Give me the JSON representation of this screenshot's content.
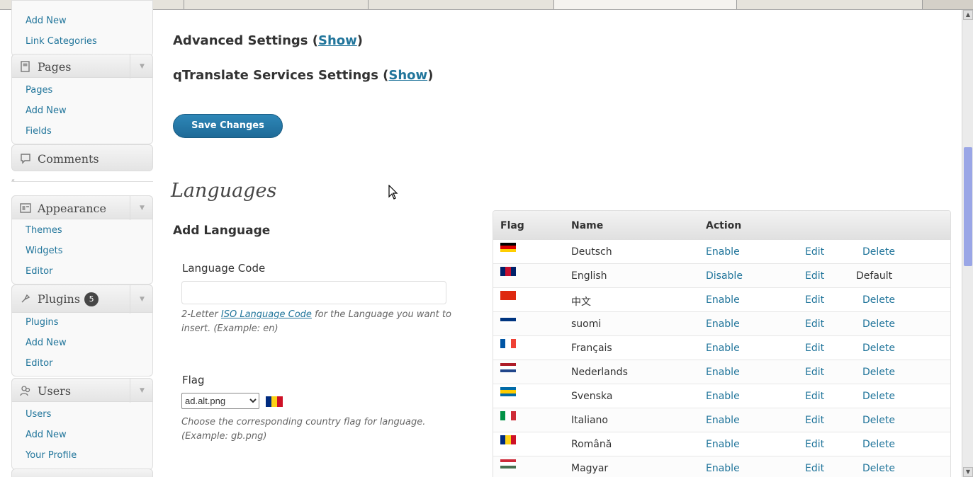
{
  "sidebar": {
    "links_add_new": "Add New",
    "links_categories": "Link Categories",
    "pages": {
      "label": "Pages",
      "items": [
        "Pages",
        "Add New",
        "Fields"
      ]
    },
    "comments": {
      "label": "Comments"
    },
    "appearance": {
      "label": "Appearance",
      "items": [
        "Themes",
        "Widgets",
        "Editor"
      ]
    },
    "plugins": {
      "label": "Plugins",
      "badge": "5",
      "items": [
        "Plugins",
        "Add New",
        "Editor"
      ]
    },
    "users": {
      "label": "Users",
      "items": [
        "Users",
        "Add New",
        "Your Profile"
      ]
    }
  },
  "main": {
    "advanced": {
      "label": "Advanced Settings (",
      "link": "Show",
      "close": ")"
    },
    "services": {
      "label": "qTranslate Services Settings (",
      "link": "Show",
      "close": ")"
    },
    "save_button": "Save Changes",
    "languages_title": "Languages",
    "add_language": "Add Language",
    "code_label": "Language Code",
    "code_value": "",
    "code_hint_pre": "2-Letter ",
    "code_hint_link": "ISO Language Code",
    "code_hint_post": " for the Language you want to insert. (Example: en)",
    "flag_label": "Flag",
    "flag_value": "ad.alt.png",
    "flag_hint": "Choose the corresponding country flag for language. (Example: gb.png)"
  },
  "table": {
    "headers": {
      "flag": "Flag",
      "name": "Name",
      "action": "Action"
    },
    "rows": [
      {
        "name": "Deutsch",
        "action": "Enable",
        "edit": "Edit",
        "last": "Delete",
        "flag": [
          "#000000",
          "#dd0000",
          "#ffce00"
        ],
        "orient": "h"
      },
      {
        "name": "English",
        "action": "Disable",
        "edit": "Edit",
        "last": "Default",
        "flag": [
          "#012169",
          "#c8102e",
          "#012169"
        ],
        "orient": "v"
      },
      {
        "name": "中文",
        "action": "Enable",
        "edit": "Edit",
        "last": "Delete",
        "flag": [
          "#de2910"
        ],
        "orient": "h"
      },
      {
        "name": "suomi",
        "action": "Enable",
        "edit": "Edit",
        "last": "Delete",
        "flag": [
          "#ffffff",
          "#003580",
          "#ffffff"
        ],
        "orient": "h"
      },
      {
        "name": "Français",
        "action": "Enable",
        "edit": "Edit",
        "last": "Delete",
        "flag": [
          "#0055a4",
          "#ffffff",
          "#ef4135"
        ],
        "orient": "v"
      },
      {
        "name": "Nederlands",
        "action": "Enable",
        "edit": "Edit",
        "last": "Delete",
        "flag": [
          "#ae1c28",
          "#ffffff",
          "#21468b"
        ],
        "orient": "h"
      },
      {
        "name": "Svenska",
        "action": "Enable",
        "edit": "Edit",
        "last": "Delete",
        "flag": [
          "#006aa7",
          "#fecc00",
          "#006aa7"
        ],
        "orient": "h"
      },
      {
        "name": "Italiano",
        "action": "Enable",
        "edit": "Edit",
        "last": "Delete",
        "flag": [
          "#009246",
          "#ffffff",
          "#ce2b37"
        ],
        "orient": "v"
      },
      {
        "name": "Română",
        "action": "Enable",
        "edit": "Edit",
        "last": "Delete",
        "flag": [
          "#002b7f",
          "#fcd116",
          "#ce1126"
        ],
        "orient": "v"
      },
      {
        "name": "Magyar",
        "action": "Enable",
        "edit": "Edit",
        "last": "Delete",
        "flag": [
          "#ce2939",
          "#ffffff",
          "#477050"
        ],
        "orient": "h"
      }
    ]
  },
  "colors": {
    "link": "#21759b",
    "button": "#21759b",
    "scroll_thumb": "#9aa6e6"
  },
  "icons": [
    "pages-icon",
    "comments-icon",
    "appearance-icon",
    "plugins-icon",
    "users-icon",
    "mouse-cursor-icon"
  ]
}
